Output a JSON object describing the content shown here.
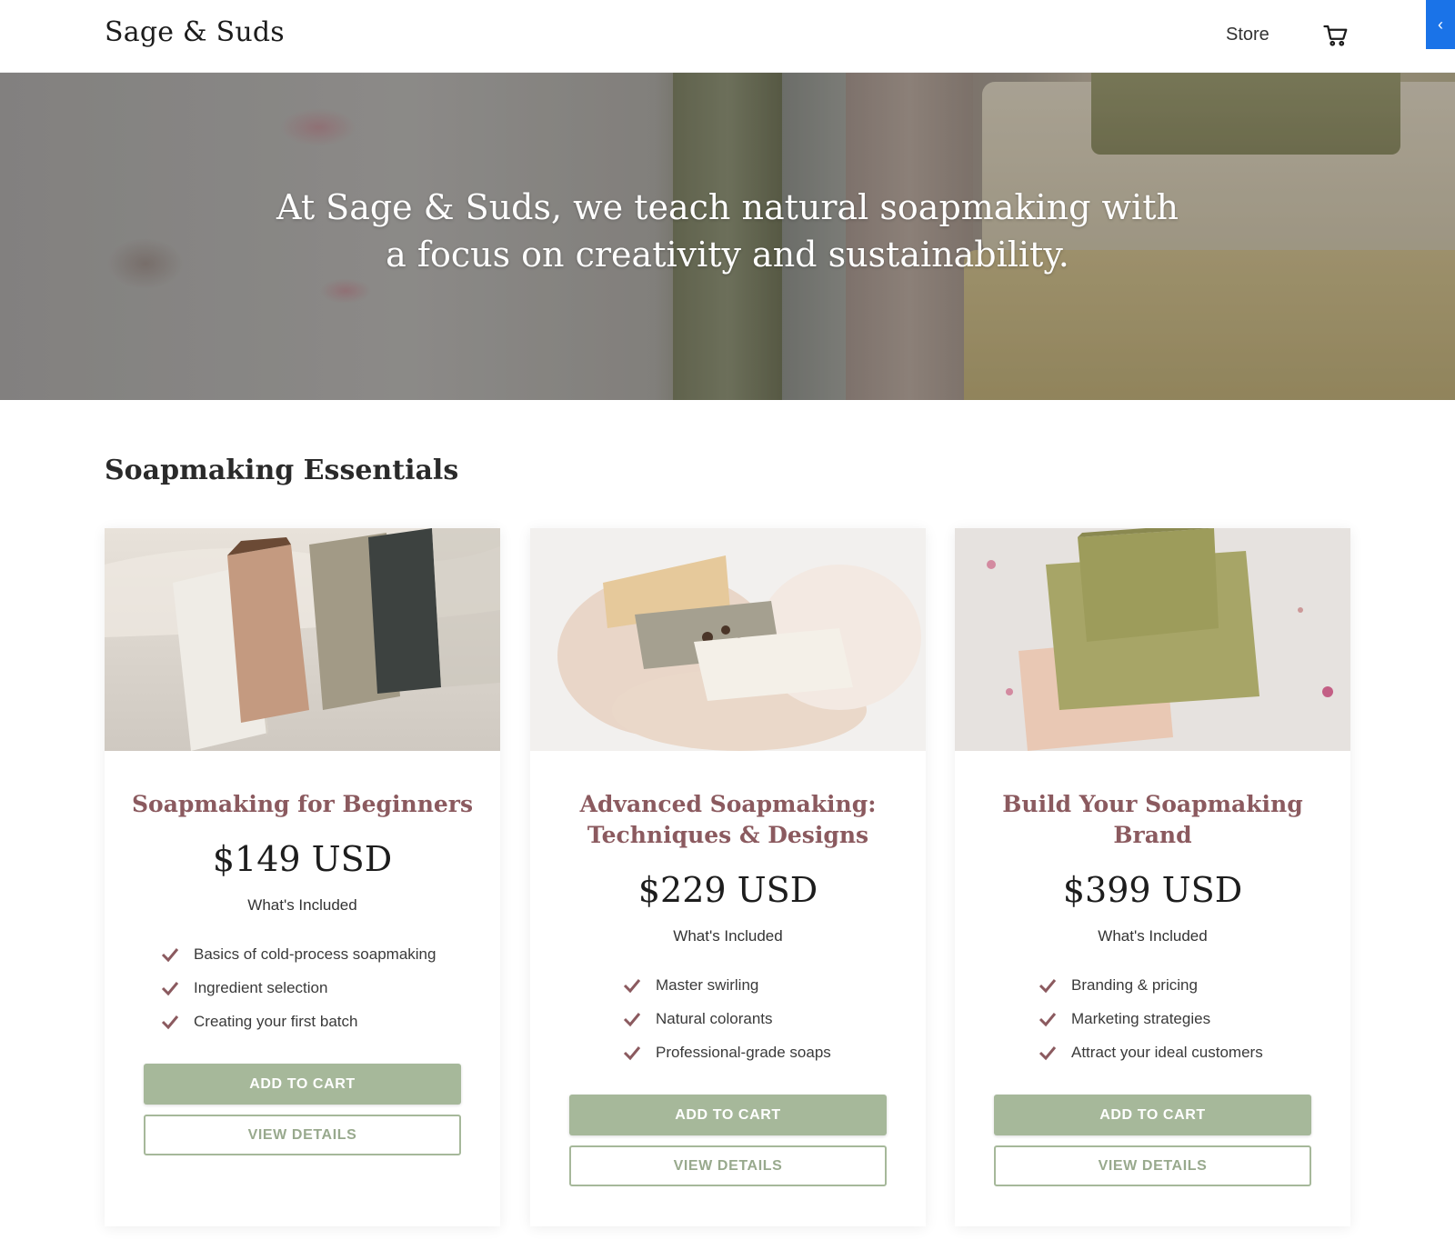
{
  "header": {
    "logo": "Sage & Suds",
    "nav": {
      "store": "Store"
    },
    "cart_icon": "cart-icon",
    "side_tab": "‹"
  },
  "hero": {
    "headline": "At Sage & Suds, we teach natural soapmaking with a focus on creativity and sustainability."
  },
  "section": {
    "title": "Soapmaking Essentials"
  },
  "colors": {
    "accent": "#a6b89a",
    "title": "#8b5a5f",
    "tab": "#1a73e8"
  },
  "products": [
    {
      "title": "Soapmaking for Beginners",
      "price": "$149 USD",
      "included_label": "What's Included",
      "features": [
        "Basics of cold-process soapmaking",
        "Ingredient selection",
        "Creating your first batch"
      ],
      "add_label": "ADD TO CART",
      "view_label": "VIEW DETAILS"
    },
    {
      "title": "Advanced Soapmaking: Techniques & Designs",
      "price": "$229 USD",
      "included_label": "What's Included",
      "features": [
        "Master swirling",
        "Natural colorants",
        "Professional-grade soaps"
      ],
      "add_label": "ADD TO CART",
      "view_label": "VIEW DETAILS"
    },
    {
      "title": "Build Your Soapmaking Brand",
      "price": "$399 USD",
      "included_label": "What's Included",
      "features": [
        "Branding & pricing",
        "Marketing strategies",
        "Attract your ideal customers"
      ],
      "add_label": "ADD TO CART",
      "view_label": "VIEW DETAILS"
    }
  ]
}
